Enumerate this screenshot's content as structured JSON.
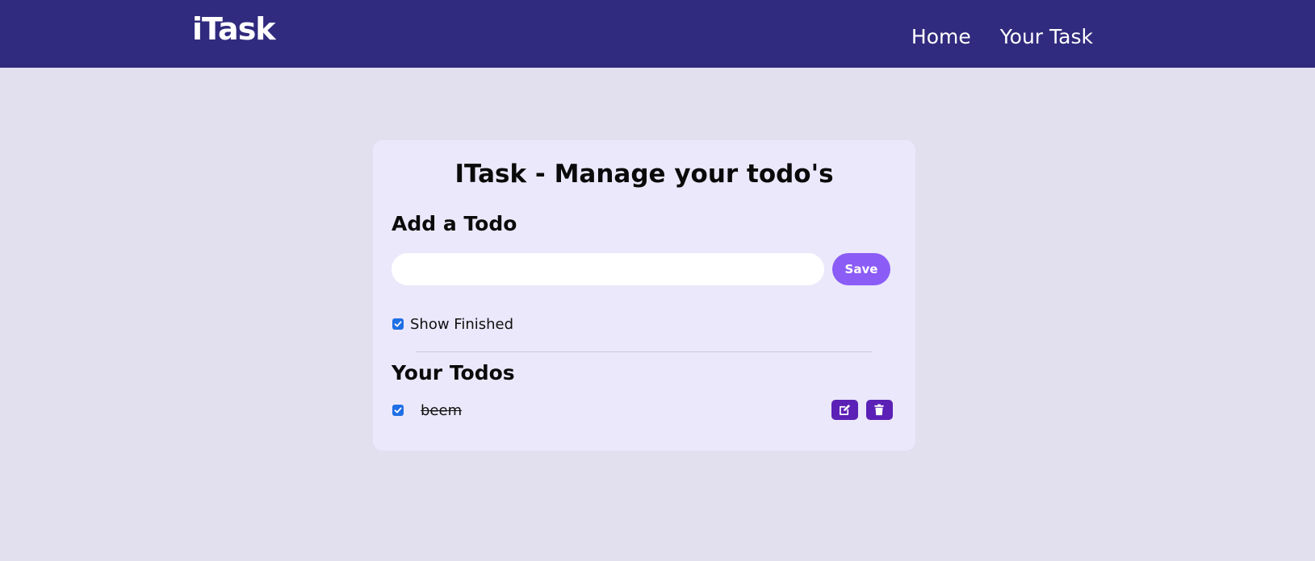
{
  "navbar": {
    "brand": "iTask",
    "links": [
      "Home",
      "Your Task"
    ]
  },
  "main": {
    "title": "ITask - Manage your todo's",
    "add_heading": "Add a Todo",
    "input_value": "",
    "save_label": "Save",
    "show_finished_label": "Show Finished",
    "show_finished_checked": true,
    "todos_heading": "Your Todos",
    "todos": [
      {
        "text": "beem",
        "completed": true
      }
    ]
  },
  "colors": {
    "navbar_bg": "#302b7e",
    "page_bg": "#e2e0ef",
    "card_bg": "#ebe8fb",
    "save_button": "#8b5cf6",
    "action_button": "#5b21b6",
    "checkbox": "#1f6fe5"
  },
  "icons": {
    "edit": "edit-icon",
    "delete": "trash-icon",
    "check": "check-icon"
  }
}
